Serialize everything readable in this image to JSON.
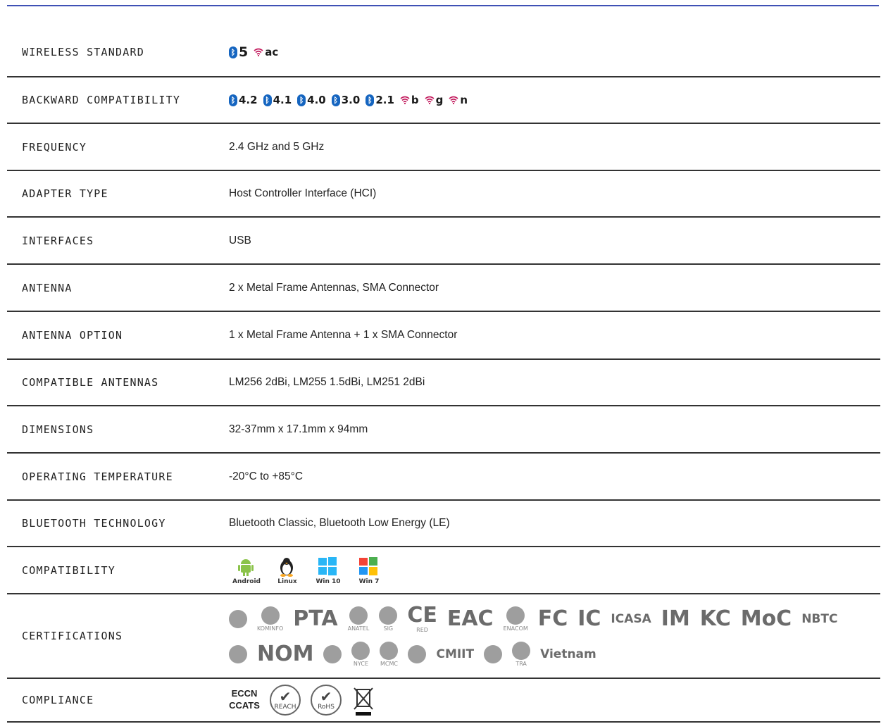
{
  "rows": [
    {
      "label": "WIRELESS STANDARD",
      "type": "badges",
      "badges": [
        {
          "kind": "bt",
          "text": "5"
        },
        {
          "kind": "wifi",
          "text": "ac"
        }
      ]
    },
    {
      "label": "BACKWARD COMPATIBILITY",
      "type": "badges",
      "badges": [
        {
          "kind": "bt",
          "text": "4.2"
        },
        {
          "kind": "bt",
          "text": "4.1"
        },
        {
          "kind": "bt",
          "text": "4.0"
        },
        {
          "kind": "bt",
          "text": "3.0"
        },
        {
          "kind": "bt",
          "text": "2.1"
        },
        {
          "kind": "wifi",
          "text": "b"
        },
        {
          "kind": "wifi",
          "text": "g"
        },
        {
          "kind": "wifi",
          "text": "n"
        }
      ]
    },
    {
      "label": "FREQUENCY",
      "type": "text",
      "value": "2.4 GHz and 5 GHz"
    },
    {
      "label": "ADAPTER TYPE",
      "type": "text",
      "value": "Host Controller Interface (HCI)"
    },
    {
      "label": "INTERFACES",
      "type": "text",
      "value": "USB"
    },
    {
      "label": "ANTENNA",
      "type": "text",
      "value": "2 x Metal Frame Antennas, SMA Connector"
    },
    {
      "label": "ANTENNA OPTION",
      "type": "text",
      "value": "1 x Metal Frame Antenna + 1 x SMA Connector"
    },
    {
      "label": "COMPATIBLE ANTENNAS",
      "type": "text",
      "value": "LM256 2dBi, LM255 1.5dBi, LM251 2dBi"
    },
    {
      "label": "DIMENSIONS",
      "type": "text",
      "value": "32-37mm x 17.1mm x 94mm"
    },
    {
      "label": "OPERATING TEMPERATURE",
      "type": "text",
      "value": "-20°C to +85°C"
    },
    {
      "label": "BLUETOOTH TECHNOLOGY",
      "type": "text",
      "value": "Bluetooth Classic, Bluetooth Low Energy (LE)"
    },
    {
      "label": "COMPATIBILITY",
      "type": "os",
      "items": [
        {
          "name": "Android",
          "icon": "android-icon"
        },
        {
          "name": "Linux",
          "icon": "linux-penguin-icon"
        },
        {
          "name": "Win 10",
          "icon": "windows-10-icon"
        },
        {
          "name": "Win 7",
          "icon": "windows-7-icon"
        }
      ]
    },
    {
      "label": "CERTIFICATIONS",
      "type": "certs",
      "line1": [
        {
          "text": "",
          "sub": "",
          "icon": "certification-mark-icon"
        },
        {
          "text": "",
          "sub": "KOMINFO",
          "icon": "kominfo-icon"
        },
        {
          "text": "PTA",
          "sub": "",
          "icon": "pta-icon"
        },
        {
          "text": "",
          "sub": "ANATEL",
          "icon": "anatel-icon"
        },
        {
          "text": "",
          "sub": "SIG",
          "icon": "bluetooth-sig-icon"
        },
        {
          "text": "CE",
          "sub": "RED",
          "icon": "ce-red-icon"
        },
        {
          "text": "EAC",
          "sub": "",
          "icon": "eac-icon"
        },
        {
          "text": "",
          "sub": "ENACOM",
          "icon": "enacom-icon"
        },
        {
          "text": "FC",
          "sub": "",
          "icon": "fcc-icon"
        },
        {
          "text": "IC",
          "sub": "",
          "icon": "ic-icon"
        },
        {
          "text": "ICASA",
          "sub": "",
          "icon": "icasa-icon"
        },
        {
          "text": "IM",
          "sub": "",
          "icon": "imda-icon"
        },
        {
          "text": "KC",
          "sub": "",
          "icon": "kc-icon"
        },
        {
          "text": "MoC",
          "sub": "",
          "icon": "moc-icon"
        },
        {
          "text": "NBTC",
          "sub": "",
          "icon": "nbtc-icon"
        }
      ],
      "line2": [
        {
          "text": "",
          "sub": "",
          "icon": "certification-mark-icon"
        },
        {
          "text": "NOM",
          "sub": "",
          "icon": "nom-icon"
        },
        {
          "text": "",
          "sub": "",
          "icon": "seal-icon"
        },
        {
          "text": "",
          "sub": "NYCE",
          "icon": "nyce-icon"
        },
        {
          "text": "",
          "sub": "MCMC",
          "icon": "mcmc-icon"
        },
        {
          "text": "",
          "sub": "",
          "icon": "certification-mark-icon"
        },
        {
          "text": "CMIIT",
          "sub": "",
          "icon": "cmiit-icon"
        },
        {
          "text": "",
          "sub": "",
          "icon": "japan-telec-icon"
        },
        {
          "text": "",
          "sub": "TRA",
          "icon": "tra-icon"
        },
        {
          "text": "Vietnam",
          "sub": "",
          "icon": "vietnam-icon"
        }
      ]
    },
    {
      "label": "COMPLIANCE",
      "type": "compliance",
      "items": [
        {
          "text": "ECCN CCATS",
          "icon": "eccn-ccats-icon"
        },
        {
          "text": "REACH",
          "icon": "reach-check-icon"
        },
        {
          "text": "RoHS",
          "icon": "rohs-check-icon"
        },
        {
          "text": "",
          "icon": "weee-bin-icon"
        }
      ]
    }
  ]
}
